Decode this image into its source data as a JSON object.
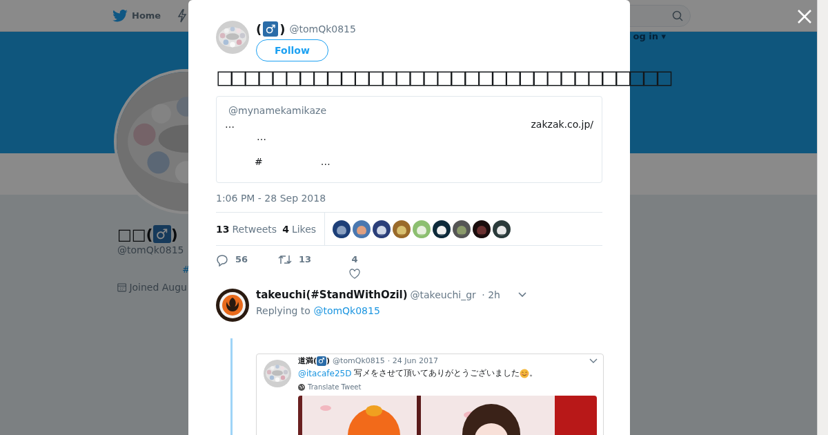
{
  "background_page": {
    "nav": {
      "home_label": "Home",
      "login_label": "og in ▾"
    },
    "profile": {
      "name_prefix": "□□(",
      "name_emoji": "♂",
      "name_suffix": ")",
      "handle": "@tomQk0815",
      "hashtag": "#",
      "joined": "Joined Augu"
    }
  },
  "tweet_modal": {
    "author": {
      "name_open": "(",
      "name_emoji": "♂",
      "name_close": ")",
      "handle": "@tomQk0815"
    },
    "follow_button": "Follow",
    "text": "□□□□□□□□□□□□□□□□□□□□□□□□□□□□□□□□□",
    "quote": {
      "handle": "@mynamekamikaze",
      "line_1_left": "…",
      "line_1_right": "zakzak.co.jp/",
      "line_2": "…",
      "line_3_hash": "#",
      "line_3_end": "…"
    },
    "timestamp": "1:06 PM - 28 Sep 2018",
    "stats": {
      "retweets_count": "13",
      "retweets_label": "Retweets",
      "likes_count": "4",
      "likes_label": "Likes"
    },
    "actions": [
      {
        "kind": "reply",
        "count": "56"
      },
      {
        "kind": "retweet",
        "count": "13"
      },
      {
        "kind": "like",
        "count": "4"
      }
    ],
    "reply": {
      "name": "takeuchi(#StandWithOzil)",
      "handle": "@takeuchi_gr",
      "time": "· 2h",
      "replying_label": "Replying to",
      "replying_handle": "@tomQk0815",
      "embedded_screenshot": {
        "name_prefix": "道満(",
        "name_emoji": "♂",
        "name_suffix": ")",
        "handle": "@tomQk0815",
        "date": "· 24 Jun 2017",
        "mention": "@itacafe25D",
        "text": "写メをさせて頂いてありがとうございました",
        "text_end": "。",
        "translate": "Translate Tweet"
      }
    }
  }
}
